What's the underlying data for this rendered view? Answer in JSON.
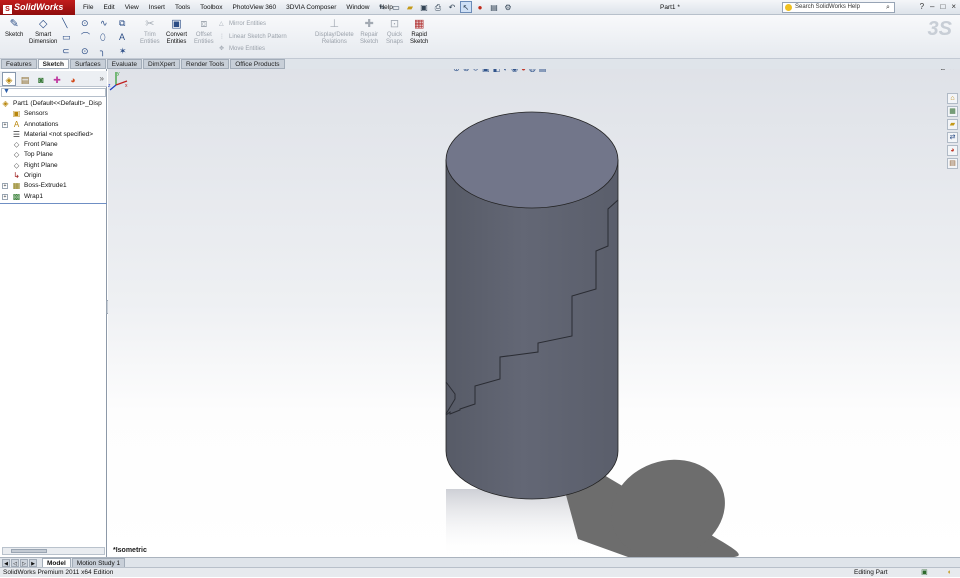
{
  "app": {
    "logo_text": "SolidWorks",
    "logo_mark": "S",
    "doc_title": "Part1 *",
    "help_search_placeholder": "Search SolidWorks Help",
    "window_controls": [
      "?",
      "–",
      "□",
      "×"
    ]
  },
  "menu": [
    "File",
    "Edit",
    "View",
    "Insert",
    "Tools",
    "Toolbox",
    "PhotoView 360",
    "3DVIA Composer",
    "Window",
    "Help"
  ],
  "quick_tools": [
    "pin-icon",
    "new-document-icon",
    "open-icon",
    "save-icon",
    "print-icon",
    "undo-icon",
    "select-icon",
    "rebuild-icon",
    "file-properties-icon",
    "options-icon"
  ],
  "command_manager": {
    "sketch": {
      "line1": "Sketch",
      "line2": ""
    },
    "smart_dimension": {
      "line1": "Smart",
      "line2": "Dimension"
    },
    "trim": {
      "line1": "Trim",
      "line2": "Entities"
    },
    "convert": {
      "line1": "Convert",
      "line2": "Entities"
    },
    "offset": {
      "line1": "Offset",
      "line2": "Entities"
    },
    "mirror": "Mirror Entities",
    "linear_pattern": "Linear Sketch Pattern",
    "move": "Move Entities",
    "display_delete": {
      "line1": "Display/Delete",
      "line2": "Relations"
    },
    "repair": {
      "line1": "Repair",
      "line2": "Sketch"
    },
    "quick_snaps": {
      "line1": "Quick",
      "line2": "Snaps"
    },
    "rapid_sketch": {
      "line1": "Rapid",
      "line2": "Sketch"
    }
  },
  "tabs": [
    {
      "label": "Features",
      "active": false
    },
    {
      "label": "Sketch",
      "active": true
    },
    {
      "label": "Surfaces",
      "active": false
    },
    {
      "label": "Evaluate",
      "active": false
    },
    {
      "label": "DimXpert",
      "active": false
    },
    {
      "label": "Render Tools",
      "active": false
    },
    {
      "label": "Office Products",
      "active": false
    }
  ],
  "feature_tree": {
    "root": "Part1  (Default<<Default>_Disp",
    "items": [
      {
        "label": "Sensors",
        "icon": "sensors-icon",
        "expandable": false
      },
      {
        "label": "Annotations",
        "icon": "annotations-icon",
        "expandable": true
      },
      {
        "label": "Material <not specified>",
        "icon": "material-icon",
        "expandable": false
      },
      {
        "label": "Front Plane",
        "icon": "plane-icon",
        "expandable": false
      },
      {
        "label": "Top Plane",
        "icon": "plane-icon",
        "expandable": false
      },
      {
        "label": "Right Plane",
        "icon": "plane-icon",
        "expandable": false
      },
      {
        "label": "Origin",
        "icon": "origin-icon",
        "expandable": false
      },
      {
        "label": "Boss-Extrude1",
        "icon": "extrude-icon",
        "expandable": true
      },
      {
        "label": "Wrap1",
        "icon": "wrap-icon",
        "expandable": true
      }
    ]
  },
  "viewport": {
    "view_label": "*Isometric",
    "triad": {
      "x": "x",
      "y": "y",
      "z": "z"
    }
  },
  "bottom_tabs": [
    {
      "label": "Model",
      "active": true
    },
    {
      "label": "Motion Study 1",
      "active": false
    }
  ],
  "status": {
    "edition": "SolidWorks Premium 2011 x64 Edition",
    "mode": "Editing Part"
  },
  "colors": {
    "logo_red": "#b01414",
    "cylinder_body": "#5f6370",
    "cylinder_top": "#72768a",
    "shadow": "#6d6d6d",
    "active_tab_bg": "#fdfdfd"
  }
}
